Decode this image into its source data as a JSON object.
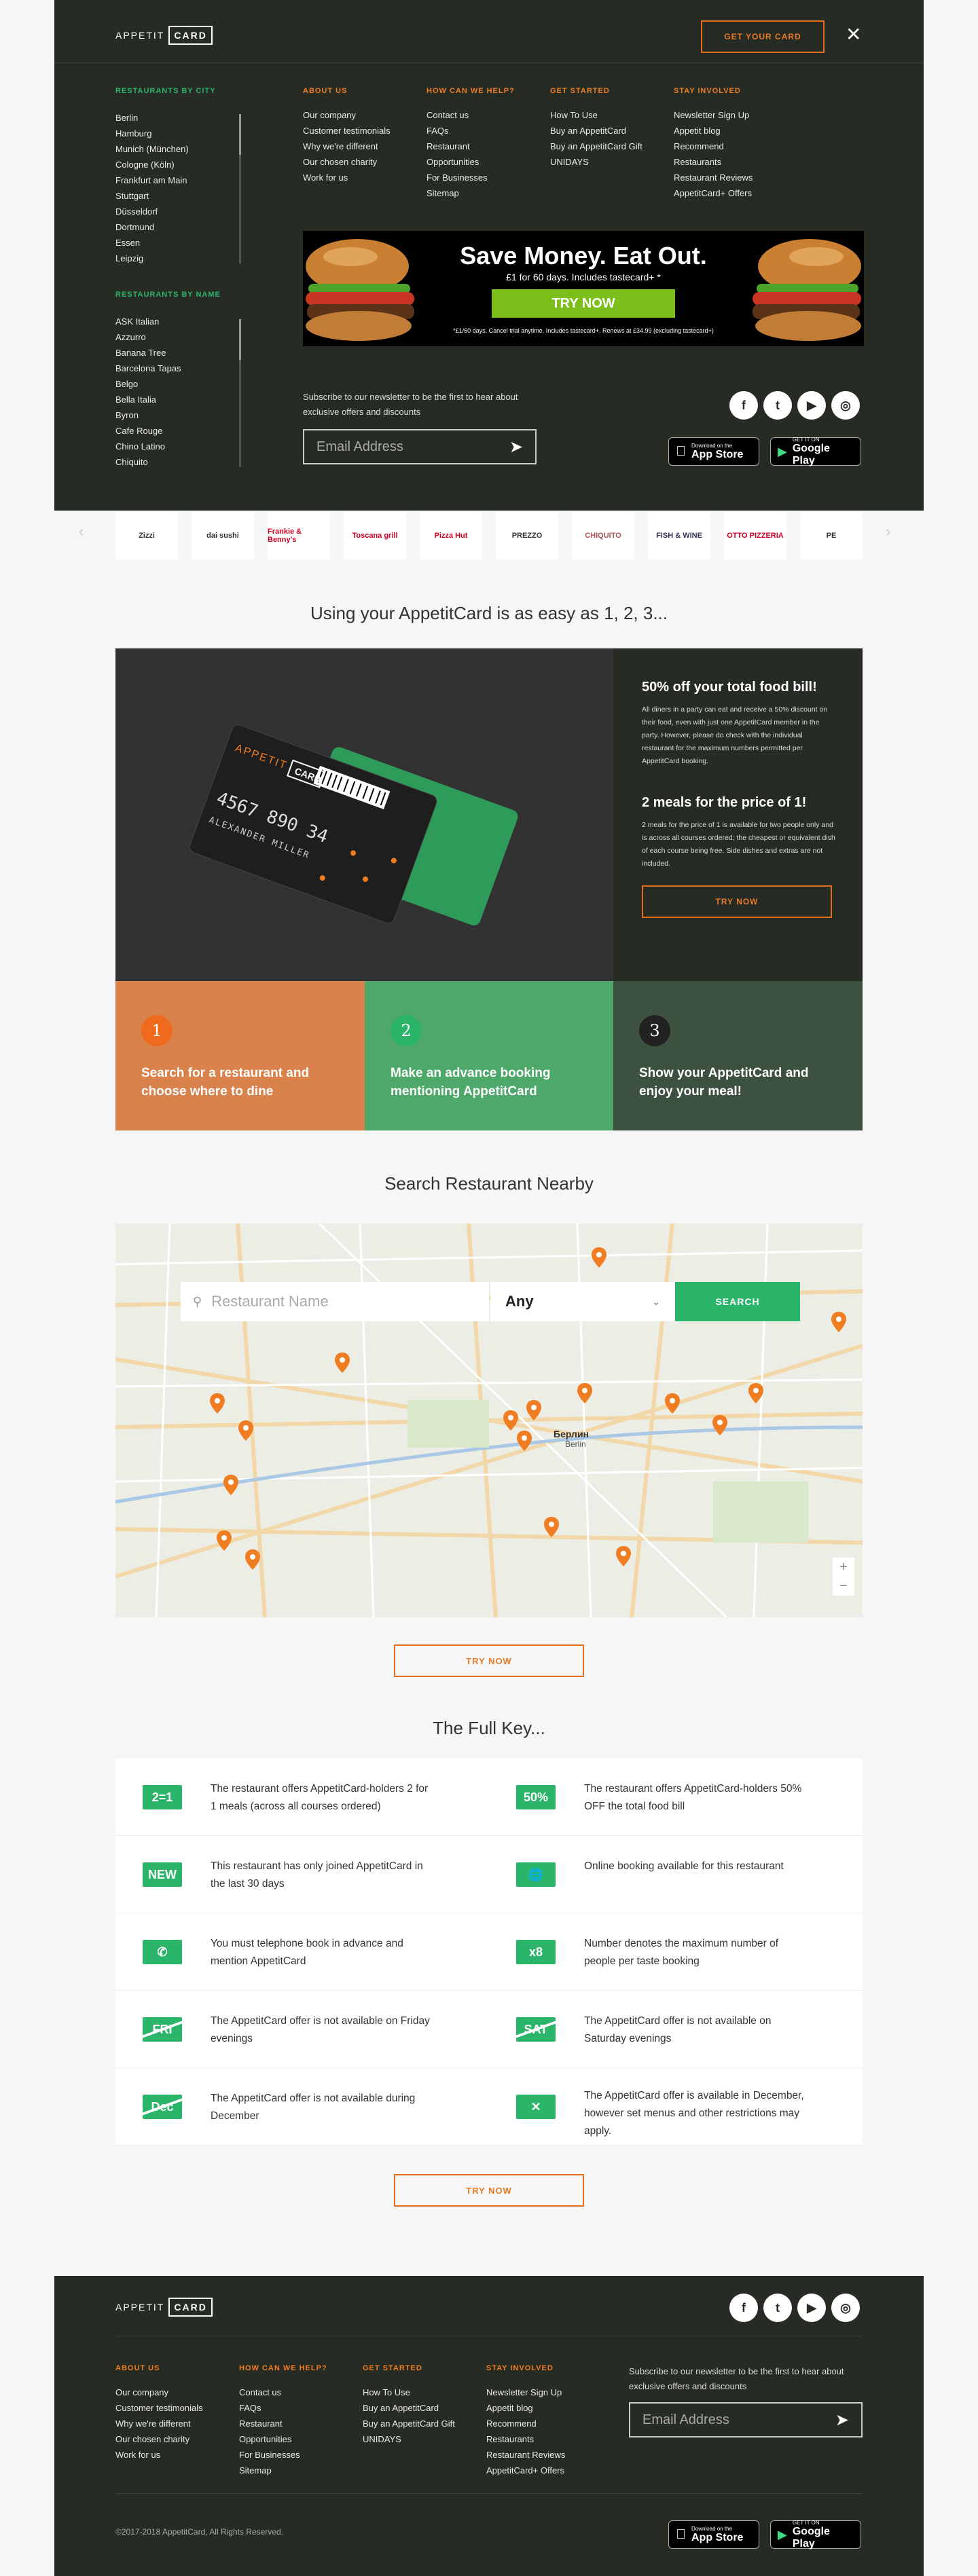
{
  "header": {
    "logo_left": "APPETIT",
    "logo_box": "CARD",
    "get_card": "GET YOUR CARD",
    "close": "✕"
  },
  "cities": {
    "heading": "RESTAURANTS BY CITY",
    "items": [
      "Berlin",
      "Hamburg",
      "Munich (München)",
      "Cologne (Köln)",
      "Frankfurt am Main",
      "Stuttgart",
      "Düsseldorf",
      "Dortmund",
      "Essen",
      "Leipzig"
    ]
  },
  "names": {
    "heading": "RESTAURANTS BY NAME",
    "items": [
      "ASK Italian",
      "Azzurro",
      "Banana Tree",
      "Barcelona Tapas",
      "Belgo",
      "Bella Italia",
      "Byron",
      "Cafe Rouge",
      "Chino Latino",
      "Chiquito"
    ]
  },
  "menu_cols": [
    {
      "heading": "ABOUT US",
      "items": [
        "Our company",
        "Customer testimonials",
        "Why we're different",
        "Our chosen charity",
        "Work for us"
      ]
    },
    {
      "heading": "HOW CAN WE HELP?",
      "items": [
        "Contact us",
        "FAQs",
        "Restaurant",
        "Opportunities",
        "For Businesses",
        "Sitemap"
      ]
    },
    {
      "heading": "GET STARTED",
      "items": [
        "How To Use",
        "Buy an AppetitCard",
        "Buy an AppetitCard Gift",
        "UNIDAYS"
      ]
    },
    {
      "heading": "STAY INVOLVED",
      "items": [
        "Newsletter Sign Up",
        "Appetit blog",
        "Recommend",
        "Restaurants",
        "Restaurant Reviews",
        "AppetitCard+ Offers"
      ]
    }
  ],
  "banner": {
    "title": "Save Money. Eat Out.",
    "sub": "£1 for 60 days. Includes tastecard+ *",
    "cta": "TRY NOW",
    "fine": "*£1/60 days. Cancel trial anytime. Includes tastecard+. Renews at £34.99 (excluding tastecard+)"
  },
  "newsletter": {
    "text": "Subscribe to our newsletter to be the first to hear about exclusive offers and discounts",
    "placeholder": "Email Address"
  },
  "stores": {
    "apple_small": "Download on the",
    "apple_big": "App Store",
    "google_small": "GET IT ON",
    "google_big": "Google Play"
  },
  "social": [
    "f",
    "t",
    "▶",
    "◎"
  ],
  "brands": [
    "Zizzi",
    "dai sushi",
    "Frankie & Benny's",
    "Toscana grill",
    "Pizza Hut",
    "PREZZO",
    "CHIQUITO",
    "FISH & WINE",
    "OTTO PIZZERIA",
    "PE"
  ],
  "steps_section": {
    "title": "Using your AppetitCard is as easy as 1, 2, 3..."
  },
  "card": {
    "logo": "APPETIT",
    "box": "CARD",
    "number": "4567 890 34",
    "holder": "ALEXANDER MILLER"
  },
  "hero": {
    "h1": "50% off your total food bill!",
    "p1": "All diners in a party can eat and receive a 50% discount on their food, even with just one AppetitCard member in the party. However, please do check with the individual restaurant for the maximum numbers permitted per AppetitCard booking.",
    "h2": "2 meals for the price of 1!",
    "p2": "2 meals for the price of 1 is available for two people only and is across all courses ordered; the cheapest or equivalent dish of each course being free. Side dishes and extras are not included.",
    "cta": "TRY NOW"
  },
  "steps": [
    {
      "num": "1",
      "text": "Search for a restaurant and choose where to dine"
    },
    {
      "num": "2",
      "text": "Make an advance booking mentioning AppetitCard"
    },
    {
      "num": "3",
      "text": "Show your AppetitCard and enjoy your meal!"
    }
  ],
  "search": {
    "title": "Search Restaurant Nearby",
    "placeholder": "Restaurant Name",
    "select_value": "Any",
    "button": "SEARCH",
    "city_label": "Берлин",
    "city_sub": "Berlin",
    "try": "TRY NOW"
  },
  "key": {
    "title": "The Full Key...",
    "try": "TRY NOW",
    "items": [
      {
        "icon": "2=1",
        "text": "The restaurant offers AppetitCard-holders 2 for 1 meals (across all courses ordered)"
      },
      {
        "icon": "50%",
        "text": "The restaurant offers AppetitCard-holders 50% OFF the total food bill"
      },
      {
        "icon": "NEW",
        "text": "This restaurant has only joined AppetitCard in the last 30 days"
      },
      {
        "icon": "globe",
        "text": "Online booking available for this restaurant"
      },
      {
        "icon": "phone",
        "text": "You must telephone book in advance and mention AppetitCard"
      },
      {
        "icon": "x8",
        "text": "Number denotes the maximum number of people per taste booking"
      },
      {
        "icon": "FRI",
        "text": "The AppetitCard offer is not available on Friday evenings"
      },
      {
        "icon": "SAT",
        "text": "The AppetitCard offer is not available on Saturday evenings"
      },
      {
        "icon": "Dec",
        "text": "The AppetitCard offer is not available during December"
      },
      {
        "icon": "cutlery",
        "text": "The AppetitCard offer is available in December, however set menus and other restrictions may apply."
      }
    ]
  },
  "footer": {
    "copyright": "©2017-2018 AppetitCard, All Rights Reserved."
  },
  "colors": {
    "dark": "#262b23",
    "orange": "#f07d22",
    "green": "#2bb56b"
  }
}
